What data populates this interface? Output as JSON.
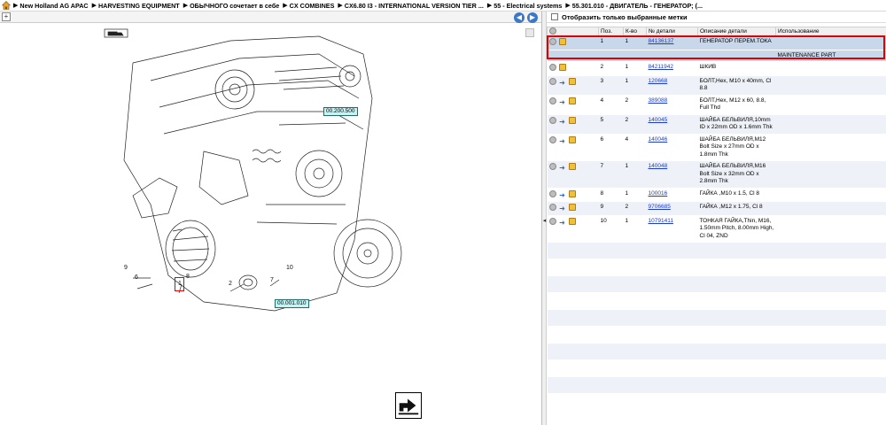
{
  "breadcrumb": {
    "items": [
      "New Holland AG APAC",
      "HARVESTING EQUIPMENT",
      "ОБЫЧНОГО сочетает в себе",
      "CX COMBINES",
      "CX6.80 I3 - INTERNATIONAL VERSION TIER ...",
      "55 - Electrical systems",
      "55.301.010 - ДВИГАТЕЛЬ - ГЕНЕРАТОР; (..."
    ]
  },
  "diagram": {
    "callout_top": "00.200.500",
    "callout_bottom": "00.001.010",
    "labels": [
      "9",
      "6",
      "8",
      "1",
      "2",
      "7",
      "10"
    ]
  },
  "filter": {
    "label": "Отобразить только выбранные метки"
  },
  "table": {
    "headers": [
      "",
      "Поз.",
      "К-во",
      "№ детали",
      "Описание детали",
      "Использование"
    ],
    "rows": [
      {
        "pos": "1",
        "qty": "1",
        "part": "84136137",
        "desc": "ГЕНЕРАТОР ПЕРЕМ.ТОКА",
        "usage": "",
        "sub": "MAINTENANCE PART"
      },
      {
        "pos": "2",
        "qty": "1",
        "part": "84211942",
        "desc": "ШКИВ",
        "usage": ""
      },
      {
        "pos": "3",
        "qty": "1",
        "part": "120668",
        "desc": "БОЛТ,Hex, M10 x 40mm, Cl 8.8",
        "usage": ""
      },
      {
        "pos": "4",
        "qty": "2",
        "part": "389088",
        "desc": "БОЛТ,Hex, M12 x 60, 8.8, Full Thd",
        "usage": ""
      },
      {
        "pos": "5",
        "qty": "2",
        "part": "140045",
        "desc": "ШАЙБА БЕЛЬВИЛЯ,10mm ID x 22mm OD x 1.6mm Thk",
        "usage": ""
      },
      {
        "pos": "6",
        "qty": "4",
        "part": "140046",
        "desc": "ШАЙБА БЕЛЬВИЛЯ,M12 Bolt Size x 27mm OD x 1.8mm Thk",
        "usage": ""
      },
      {
        "pos": "7",
        "qty": "1",
        "part": "140048",
        "desc": "ШАЙБА БЕЛЬВИЛЯ,M16 Bolt Size x 32mm OD x 2.8mm Thk",
        "usage": ""
      },
      {
        "pos": "8",
        "qty": "1",
        "part": "100016",
        "desc": "ГАЙКА ,M10 x 1.5, Cl 8",
        "usage": ""
      },
      {
        "pos": "9",
        "qty": "2",
        "part": "9706685",
        "desc": "ГАЙКА ,M12 x 1.75, Cl 8",
        "usage": ""
      },
      {
        "pos": "10",
        "qty": "1",
        "part": "10791411",
        "desc": "ТОНКАЯ ГАЙКА,Thin, M16, 1.50mm Pitch, 8.00mm High, Cl 04, ZND",
        "usage": ""
      }
    ]
  }
}
